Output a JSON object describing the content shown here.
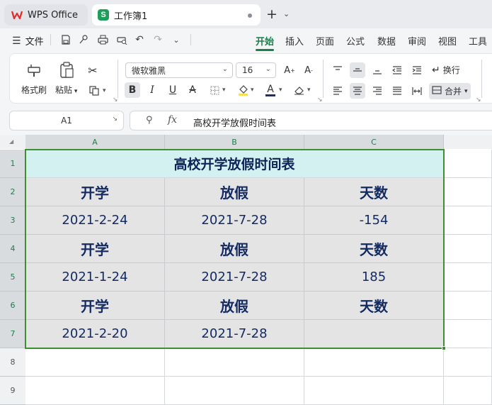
{
  "tabs": {
    "app_tab_label": "WPS Office",
    "doc_tab_label": "工作簿1",
    "doc_tab_icon": "S"
  },
  "menu": {
    "file_label": "文件",
    "ribbon_tabs": [
      "开始",
      "插入",
      "页面",
      "公式",
      "数据",
      "审阅",
      "视图",
      "工具"
    ],
    "active_tab": "开始"
  },
  "ribbon": {
    "format_painter_label": "格式刷",
    "paste_label": "粘贴",
    "font_name": "微软雅黑",
    "font_size": "16",
    "wrap_text_label": "换行",
    "merge_label": "合并"
  },
  "formula_bar": {
    "cell_ref": "A1",
    "fx_label": "fx",
    "content": "高校开学放假时间表"
  },
  "sheet": {
    "columns": [
      "A",
      "B",
      "C"
    ],
    "rows": [
      "1",
      "2",
      "3",
      "4",
      "5",
      "6",
      "7",
      "8",
      "9"
    ],
    "title": "高校开学放假时间表",
    "data": [
      [
        "开学",
        "放假",
        "天数"
      ],
      [
        "2021-2-24",
        "2021-7-28",
        "-154"
      ],
      [
        "开学",
        "放假",
        "天数"
      ],
      [
        "2021-1-24",
        "2021-7-28",
        "185"
      ],
      [
        "开学",
        "放假",
        "天数"
      ],
      [
        "2021-2-20",
        "2021-7-28",
        ""
      ]
    ]
  },
  "colors": {
    "accent_green": "#1a7f4b",
    "selection_border": "#3e8f31",
    "title_fill": "#d2f1f0",
    "selection_fill": "#e4e4e4",
    "text_navy": "#142a63"
  }
}
